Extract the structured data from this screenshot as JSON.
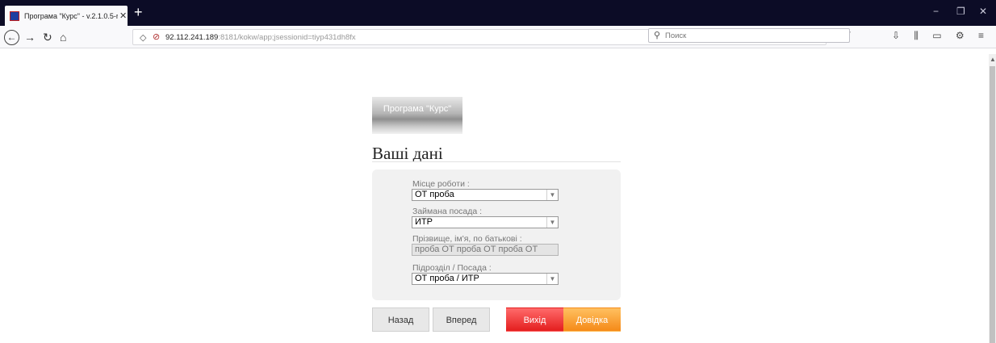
{
  "browser": {
    "tab_title": "Програма \"Курс\" - v.2.1.0.5-rc",
    "tab_close": "✕",
    "new_tab": "+",
    "window_controls": [
      "−",
      "❐",
      "✕"
    ],
    "url_host": "92.112.241.189",
    "url_rest": ":8181/kokw/app;jsessionid=tiyp431dh8fx",
    "search_placeholder": "Поиск",
    "url_actions": "··· ⊙ ☆"
  },
  "page": {
    "program_button": "Програма \"Курс\"",
    "heading": "Ваші дані"
  },
  "form": {
    "workplace_label": "Місце роботи :",
    "workplace_value": "ОТ проба",
    "position_label": "Займана посада :",
    "position_value": "ИТР",
    "fullname_label": "Прізвище, ім'я, по батькові :",
    "fullname_value": "проба ОТ проба ОТ проба ОТ",
    "division_label": "Підрозділ / Посада :",
    "division_value": "ОТ проба / ИТР"
  },
  "buttons": {
    "back": "Назад",
    "forward": "Вперед",
    "exit": "Вихід",
    "help": "Довідка"
  },
  "colors": {
    "exit": "#e41e1e",
    "help": "#f58a18",
    "tabbar": "#0c0c26"
  }
}
